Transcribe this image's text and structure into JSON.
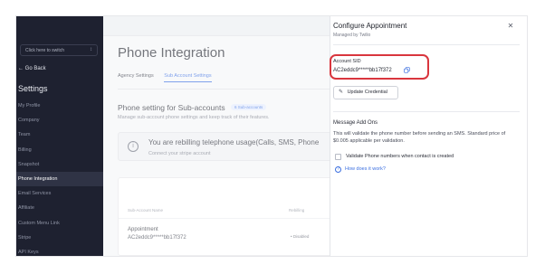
{
  "sidebar": {
    "switch_label": "Click here to switch",
    "go_back": "Go Back",
    "settings_heading": "Settings",
    "items": [
      {
        "label": "My Profile"
      },
      {
        "label": "Company"
      },
      {
        "label": "Team"
      },
      {
        "label": "Billing"
      },
      {
        "label": "Snapshot"
      },
      {
        "label": "Phone Integration",
        "active": true
      },
      {
        "label": "Email Services"
      },
      {
        "label": "Affiliate"
      },
      {
        "label": "Custom Menu Link"
      },
      {
        "label": "Stripe"
      },
      {
        "label": "API Keys"
      }
    ]
  },
  "main": {
    "title": "Phone Integration",
    "tabs": [
      {
        "label": "Agency Settings"
      },
      {
        "label": "Sub Account Settings",
        "active": true
      }
    ],
    "section_title": "Phone setting for Sub-accounts",
    "section_badge": "6 Sub-accounts",
    "section_subtitle": "Manage sub-account phone settings and keep track of their features.",
    "alert": {
      "title": "You are rebilling telephone usage(Calls, SMS, Phone",
      "subtitle": "Connect your stripe account"
    },
    "table": {
      "headers": [
        "Sub-Account Name",
        "Rebilling"
      ],
      "rows": [
        {
          "name": "Appointment",
          "sid": "AC2eddc9*****bb17f372",
          "status": "Disabled"
        }
      ]
    }
  },
  "drawer": {
    "title": "Configure Appointment",
    "subtitle": "Managed by Twilio",
    "account_sid_label": "Account SID",
    "account_sid_value": "AC2eddc9*****bb17f372",
    "update_button": "Update Credential",
    "message_addons_title": "Message Add Ons",
    "message_addons_desc": "This will validate the phone number before sending an SMS. Standard price of $0.005 applicable per validation.",
    "validate_checkbox_label": "Validate Phone numbers when contact is created",
    "help_link": "How does it work?"
  },
  "colors": {
    "sidebar_bg": "#1e2130",
    "accent": "#3b6fe0",
    "highlight_box": "#d9363e"
  }
}
